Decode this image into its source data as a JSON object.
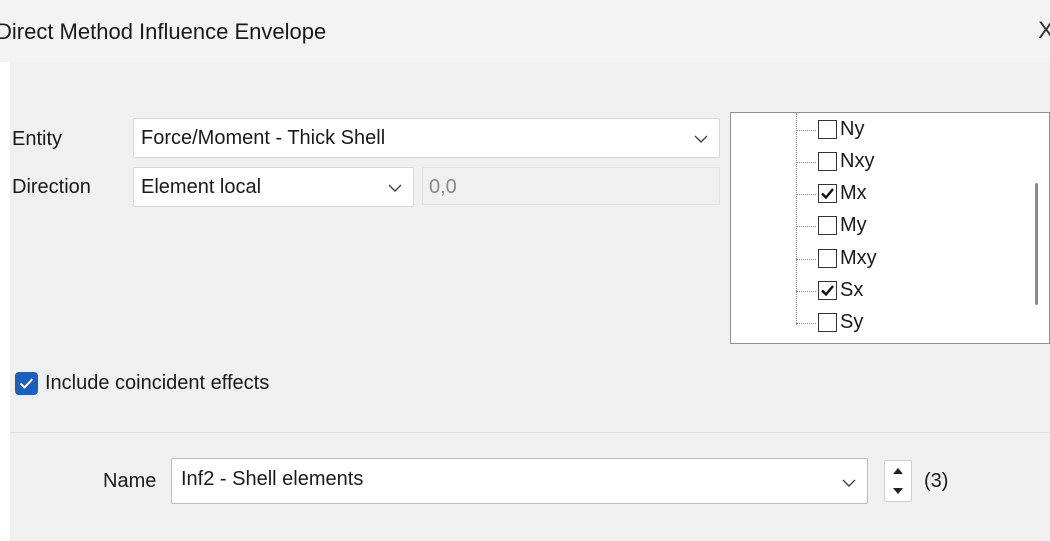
{
  "window": {
    "title": "Direct Method Influence Envelope",
    "close_glyph": "X"
  },
  "entity": {
    "label": "Entity",
    "value": "Force/Moment - Thick Shell"
  },
  "direction": {
    "label": "Direction",
    "value": "Element local",
    "angle_value": "0,0"
  },
  "components": [
    {
      "label": "Ny",
      "checked": false
    },
    {
      "label": "Nxy",
      "checked": false
    },
    {
      "label": "Mx",
      "checked": true
    },
    {
      "label": "My",
      "checked": false
    },
    {
      "label": "Mxy",
      "checked": false
    },
    {
      "label": "Sx",
      "checked": true
    },
    {
      "label": "Sy",
      "checked": false
    }
  ],
  "include_coincident": {
    "label": "Include coincident effects",
    "checked": true
  },
  "name": {
    "label": "Name",
    "value": "Inf2 - Shell elements",
    "count": "(3)"
  },
  "colors": {
    "accent": "#1b5fc1",
    "panel_bg": "#f0f0f0",
    "title_bg": "#f3f3f3"
  }
}
